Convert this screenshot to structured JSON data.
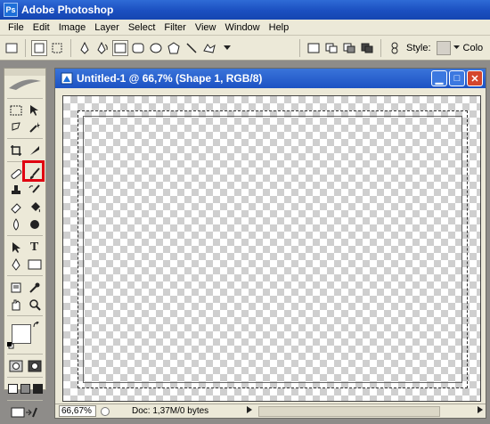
{
  "app": {
    "title": "Adobe Photoshop",
    "logo": "Ps"
  },
  "menu": [
    "File",
    "Edit",
    "Image",
    "Layer",
    "Select",
    "Filter",
    "View",
    "Window",
    "Help"
  ],
  "options": {
    "style_label": "Style:",
    "color_label": "Colo"
  },
  "document": {
    "title": "Untitled-1 @ 66,7% (Shape 1, RGB/8)",
    "zoom": "66,67%",
    "doc_info": "Doc: 1,37M/0 bytes"
  },
  "toolbox": {
    "text_tool": "T"
  }
}
